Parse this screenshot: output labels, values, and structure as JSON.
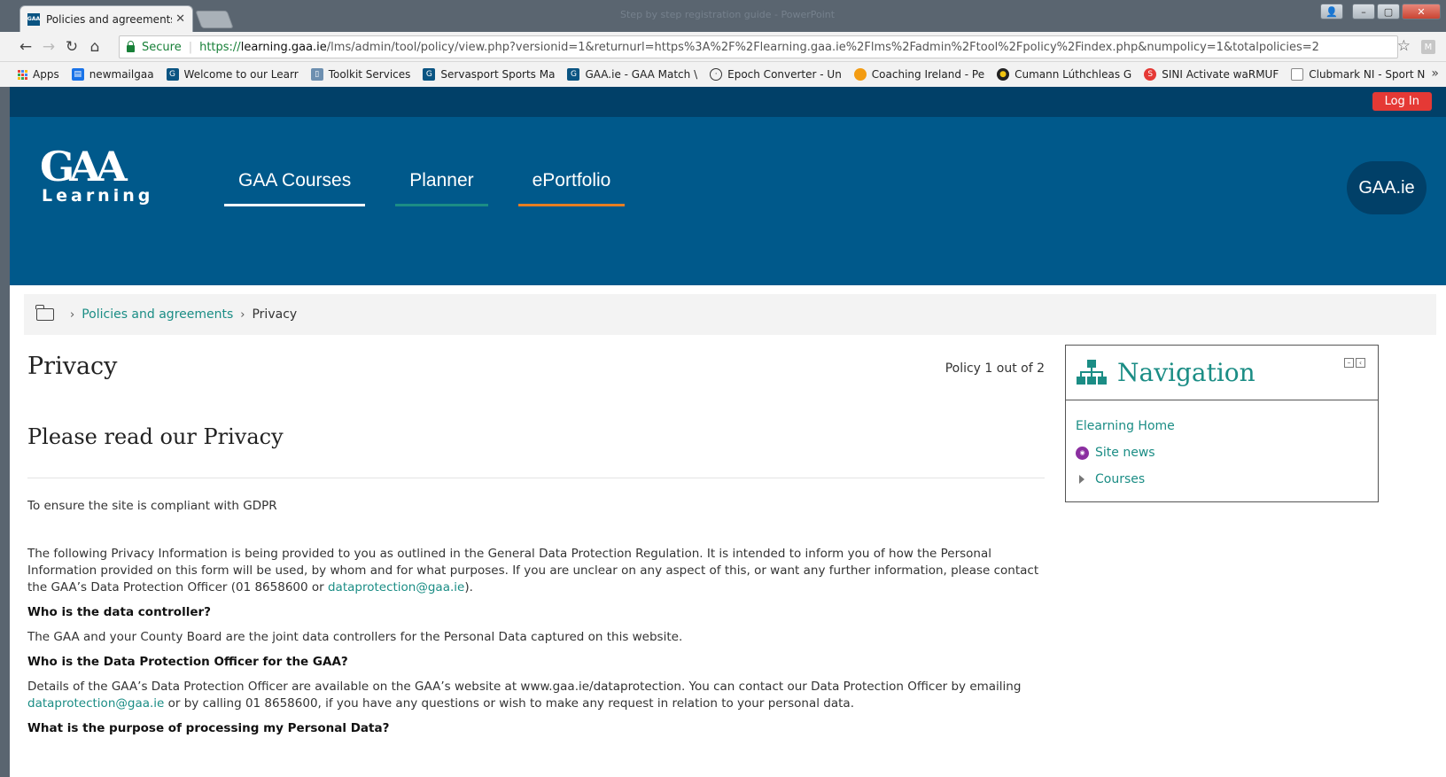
{
  "browser": {
    "tab_title": "Policies and agreements",
    "tab_favicon": "GAA",
    "window_title": "Step by step registration guide - PowerPoint",
    "secure_label": "Secure",
    "url_scheme": "https://",
    "url_host": "learning.gaa.ie",
    "url_path": "/lms/admin/tool/policy/view.php?versionid=1&returnurl=https%3A%2F%2Flearning.gaa.ie%2Flms%2Fadmin%2Ftool%2Fpolicy%2Findex.php&numpolicy=1&totalpolicies=2",
    "extension_letter": "M"
  },
  "bookmarks": [
    {
      "label": "Apps",
      "icon": "apps-grid-icon",
      "color": "#4285f4"
    },
    {
      "label": "newmailgaa",
      "icon": "calendar-icon",
      "color": "#1a73e8"
    },
    {
      "label": "Welcome to our Learr",
      "icon": "gaa-icon",
      "color": "#0a5482"
    },
    {
      "label": "Toolkit Services",
      "icon": "document-icon",
      "color": "#6d8fb0"
    },
    {
      "label": "Servasport Sports Ma",
      "icon": "gaa-icon",
      "color": "#0a5482"
    },
    {
      "label": "GAA.ie - GAA Match \\",
      "icon": "gaa-icon",
      "color": "#0a5482"
    },
    {
      "label": "Epoch Converter - Un",
      "icon": "clock-icon",
      "color": "#333333"
    },
    {
      "label": "Coaching Ireland - Pe",
      "icon": "coaching-icon",
      "color": "#f39c12"
    },
    {
      "label": "Cumann Lúthchleas G",
      "icon": "gaa-crest-icon",
      "color": "#222222"
    },
    {
      "label": "SINI Activate waRMUF",
      "icon": "sini-icon",
      "color": "#e53935"
    },
    {
      "label": "Clubmark NI - Sport N",
      "icon": "page-icon",
      "color": "#888888"
    }
  ],
  "site": {
    "login_label": "Log In",
    "logo_mark": "GAA",
    "logo_word": "Learning",
    "menu": [
      {
        "label": "GAA Courses",
        "underline": "#ffffff"
      },
      {
        "label": "Planner",
        "underline": "#1b8d85"
      },
      {
        "label": "ePortfolio",
        "underline": "#e67e22"
      }
    ],
    "gaa_link": "GAA.ie"
  },
  "breadcrumb": {
    "link": "Policies and agreements",
    "current": "Privacy"
  },
  "content": {
    "title": "Privacy",
    "policy_count": "Policy 1 out of 2",
    "subtitle": "Please read our Privacy",
    "summary": "To ensure the site is compliant with GDPR",
    "intro_before": "The following Privacy Information is being provided to you as outlined in the General Data Protection Regulation.  It is intended to inform you of how the Personal Information provided on this form will be used, by whom and for what purposes.  If you are unclear on any aspect of this, or want any further information, please contact the GAA’s Data Protection Officer (01 8658600 or ",
    "intro_email": "dataprotection@gaa.ie",
    "intro_after": ").",
    "q1": "Who is the data controller?",
    "a1": "The GAA and your County Board are the joint data controllers for the Personal Data captured on this website.",
    "q2": "Who is the Data Protection Officer for the GAA?",
    "a2_before": "Details of the GAA’s Data Protection Officer are available on the GAA’s website at www.gaa.ie/dataprotection.  You can contact our Data Protection Officer by emailing ",
    "a2_email": "dataprotection@gaa.ie",
    "a2_after": " or by calling 01 8658600, if you have any questions or wish to make any request in relation to your personal data.",
    "q3": "What is the purpose of processing my Personal Data?"
  },
  "navigation_block": {
    "title": "Navigation",
    "items": [
      {
        "label": "Elearning Home"
      },
      {
        "label": "Site news"
      },
      {
        "label": "Courses"
      }
    ]
  }
}
